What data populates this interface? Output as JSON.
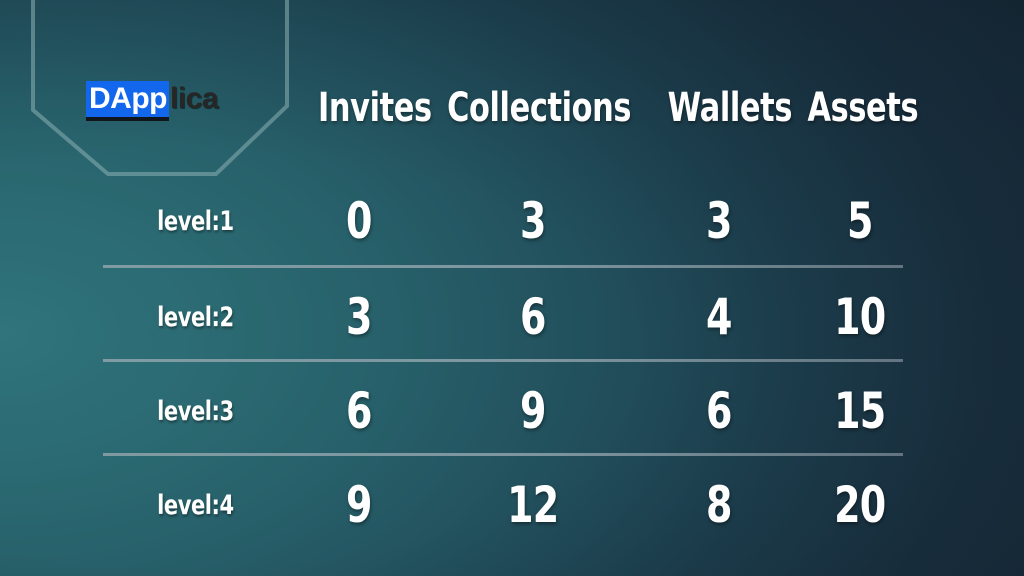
{
  "brand": {
    "logo_mark": "DApp",
    "logo_tail": "lica",
    "mark_bg_color": "#1267ec",
    "mark_text_color": "#ffffff",
    "tail_text_color": "#262626",
    "badge_shape": "hexagon-outline"
  },
  "theme": {
    "background_left": "#2e7078",
    "background_right": "#182836",
    "text_color": "#ffffff",
    "divider_color": "#8fa3ab"
  },
  "table": {
    "row_label_header": "",
    "columns": [
      {
        "label": "Invites"
      },
      {
        "label": "Collections"
      },
      {
        "label": "Wallets"
      },
      {
        "label": "Assets"
      }
    ],
    "rows": [
      {
        "label": "level:1",
        "values": [
          "0",
          "3",
          "3",
          "5"
        ]
      },
      {
        "label": "level:2",
        "values": [
          "3",
          "6",
          "4",
          "10"
        ]
      },
      {
        "label": "level:3",
        "values": [
          "6",
          "9",
          "6",
          "15"
        ]
      },
      {
        "label": "level:4",
        "values": [
          "9",
          "12",
          "8",
          "20"
        ]
      }
    ]
  },
  "chart_data": {
    "type": "table",
    "title": "",
    "categories": [
      "level:1",
      "level:2",
      "level:3",
      "level:4"
    ],
    "series": [
      {
        "name": "Invites",
        "values": [
          0,
          3,
          6,
          9
        ]
      },
      {
        "name": "Collections",
        "values": [
          3,
          6,
          9,
          12
        ]
      },
      {
        "name": "Wallets",
        "values": [
          3,
          4,
          6,
          8
        ]
      },
      {
        "name": "Assets",
        "values": [
          5,
          10,
          15,
          20
        ]
      }
    ]
  }
}
